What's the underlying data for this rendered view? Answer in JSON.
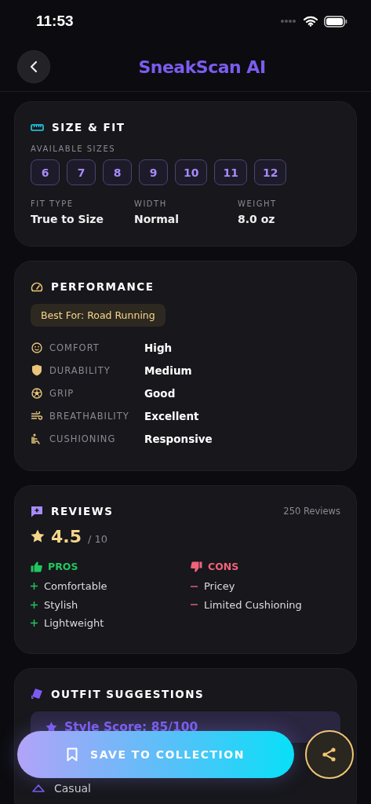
{
  "status_bar": {
    "time": "11:53"
  },
  "header": {
    "title": "SneakScan AI"
  },
  "size_fit": {
    "title": "SIZE & FIT",
    "sizes_label": "AVAILABLE SIZES",
    "sizes": [
      "6",
      "7",
      "8",
      "9",
      "10",
      "11",
      "12"
    ],
    "specs": [
      {
        "label": "FIT TYPE",
        "value": "True to Size"
      },
      {
        "label": "WIDTH",
        "value": "Normal"
      },
      {
        "label": "WEIGHT",
        "value": "8.0 oz"
      }
    ]
  },
  "performance": {
    "title": "PERFORMANCE",
    "best_for": "Best For: Road Running",
    "metrics": [
      {
        "label": "COMFORT",
        "value": "High"
      },
      {
        "label": "DURABILITY",
        "value": "Medium"
      },
      {
        "label": "GRIP",
        "value": "Good"
      },
      {
        "label": "BREATHABILITY",
        "value": "Excellent"
      },
      {
        "label": "CUSHIONING",
        "value": "Responsive"
      }
    ]
  },
  "reviews": {
    "title": "REVIEWS",
    "count": "250 Reviews",
    "rating": "4.5",
    "scale": "/ 10",
    "pros": {
      "title": "PROS",
      "items": [
        "Comfortable",
        "Stylish",
        "Lightweight"
      ]
    },
    "cons": {
      "title": "CONS",
      "items": [
        "Pricey",
        "Limited Cushioning"
      ]
    }
  },
  "outfit": {
    "title": "OUTFIT SUGGESTIONS",
    "style_score": "Style Score: 85/100",
    "items": [
      "Casual"
    ]
  },
  "actions": {
    "save": "SAVE TO COLLECTION"
  }
}
